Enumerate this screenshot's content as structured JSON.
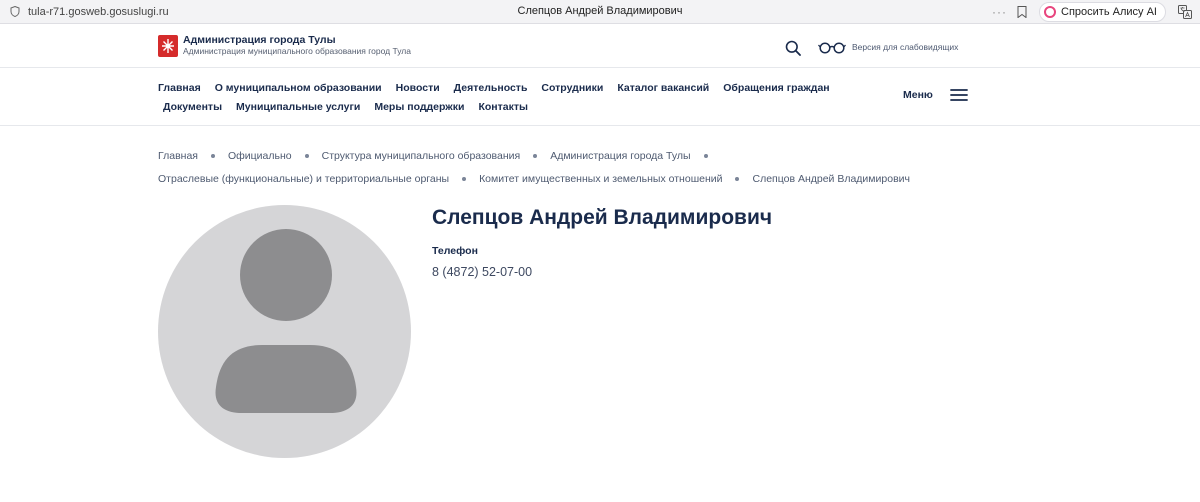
{
  "browser": {
    "url": "tula-r71.gosweb.gosuslugi.ru",
    "tab_title": "Слепцов Андрей Владимирович",
    "more_label": "···",
    "alice_label": "Спросить Алису AI"
  },
  "header": {
    "org_title": "Администрация города Тулы",
    "org_subtitle": "Администрация муниципального образования город Тула",
    "low_vision_label": "Версия для слабовидящих"
  },
  "nav": {
    "row1": [
      "Главная",
      "О муниципальном образовании",
      "Новости",
      "Деятельность",
      "Сотрудники",
      "Каталог вакансий",
      "Обращения граждан"
    ],
    "row2": [
      "Документы",
      "Муниципальные услуги",
      "Меры поддержки",
      "Контакты"
    ],
    "menu_label": "Меню"
  },
  "breadcrumbs": {
    "row1": [
      "Главная",
      "Официально",
      "Структура муниципального образования",
      "Администрация города Тулы"
    ],
    "row2": [
      "Отраслевые (функциональные) и территориальные органы",
      "Комитет имущественных и земельных отношений",
      "Слепцов Андрей Владимирович"
    ]
  },
  "profile": {
    "name": "Слепцов Андрей Владимирович",
    "phone_label": "Телефон",
    "phone_value": "8 (4872) 52-07-00"
  },
  "colors": {
    "brand_red": "#d52b2b",
    "text_dark": "#1a2b4c",
    "avatar_bg": "#d5d5d7",
    "avatar_fg": "#8d8d8f"
  }
}
